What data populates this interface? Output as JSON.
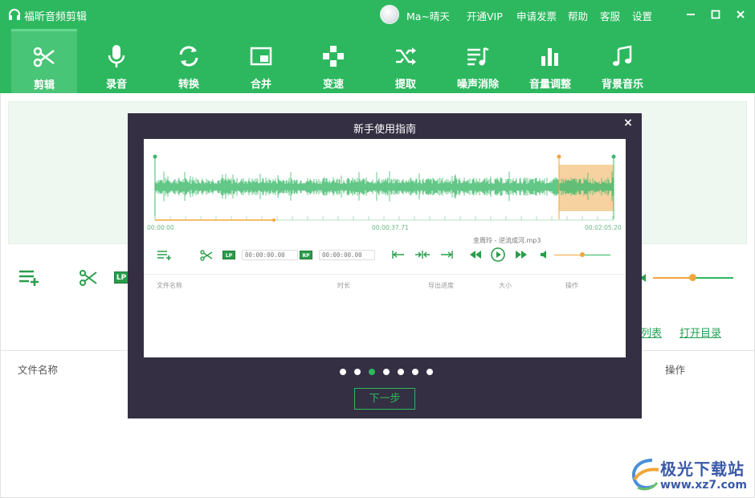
{
  "app": {
    "title": "福昕音频剪辑"
  },
  "header": {
    "username": "Ma~晴天",
    "links": [
      "开通VIP",
      "申请发票",
      "帮助",
      "客服",
      "设置"
    ]
  },
  "toolbar": {
    "items": [
      {
        "label": "剪辑",
        "icon": "scissors-icon"
      },
      {
        "label": "录音",
        "icon": "microphone-icon"
      },
      {
        "label": "转换",
        "icon": "convert-icon"
      },
      {
        "label": "合并",
        "icon": "merge-icon"
      },
      {
        "label": "变速",
        "icon": "speed-icon"
      },
      {
        "label": "提取",
        "icon": "extract-icon"
      },
      {
        "label": "噪声消除",
        "icon": "noise-icon"
      },
      {
        "label": "音量调整",
        "icon": "volume-bars-icon"
      },
      {
        "label": "背景音乐",
        "icon": "music-note-icon"
      }
    ],
    "active_index": 0
  },
  "background": {
    "lp_tag": "LP",
    "links": [
      "列表",
      "打开目录"
    ],
    "columns": {
      "name": "文件名称",
      "action": "操作"
    }
  },
  "modal": {
    "title": "新手使用指南",
    "close": "×",
    "guide": {
      "times": [
        "00:00:00",
        "00:00:37.71",
        "00:02:05.20"
      ],
      "filename": "金周玲 - 逆流成河.mp3",
      "lp": "LP",
      "rp": "RP",
      "start_time": "00:00:00.00",
      "end_time": "00:00:00.00",
      "columns": [
        "文件名称",
        "时长",
        "导出进度",
        "大小",
        "操作"
      ]
    },
    "page_count": 7,
    "current_page": 3,
    "next_label": "下一步"
  },
  "watermark": {
    "title": "极光下载站",
    "url": "www.xz7.com"
  },
  "colors": {
    "brand": "#2db85f",
    "modal_bg": "#342f42",
    "accent": "#f0a63a"
  }
}
